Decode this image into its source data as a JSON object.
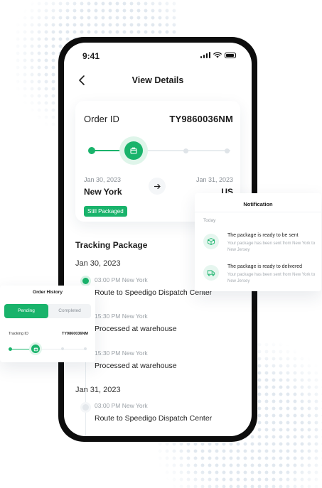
{
  "status_bar": {
    "time": "9:41"
  },
  "header": {
    "title": "View Details"
  },
  "order": {
    "id_label": "Order ID",
    "id_value": "TY9860036NM",
    "from_date": "Jan 30, 2023",
    "from_city": "New York",
    "to_date": "Jan 31, 2023",
    "to_city": "US",
    "status": "Still Packaged"
  },
  "tracking": {
    "title": "Tracking Package",
    "groups": [
      {
        "date": "Jan 30, 2023",
        "events": [
          {
            "time": "03:00 PM New York",
            "desc": "Route to Speedigo Dispatch Center",
            "active": true
          },
          {
            "time": "15:30 PM New York",
            "desc": "Processed at warehouse",
            "active": false
          },
          {
            "time": "15:30 PM New York",
            "desc": "Processed at warehouse",
            "active": false
          }
        ]
      },
      {
        "date": "Jan 31, 2023",
        "events": [
          {
            "time": "03:00 PM New York",
            "desc": "Route to Speedigo Dispatch Center",
            "active": false
          }
        ]
      }
    ]
  },
  "notification": {
    "title": "Notification",
    "section": "Today",
    "items": [
      {
        "icon": "box-icon",
        "title": "The package is ready to be sent",
        "body": "Your package has been sent from New York to New Jersey"
      },
      {
        "icon": "truck-icon",
        "title": "The package is ready to delivered",
        "body": "Your package has been sent from New York to New Jersey"
      }
    ]
  },
  "order_history": {
    "title": "Order History",
    "tabs": [
      "Pending",
      "Completed"
    ],
    "tracking_label": "Tracking ID",
    "tracking_value": "TY9860036NM"
  },
  "colors": {
    "accent": "#19b36b",
    "accent_light": "#dff5ea",
    "text": "#1b1b1b",
    "muted": "#9aa0a6"
  }
}
